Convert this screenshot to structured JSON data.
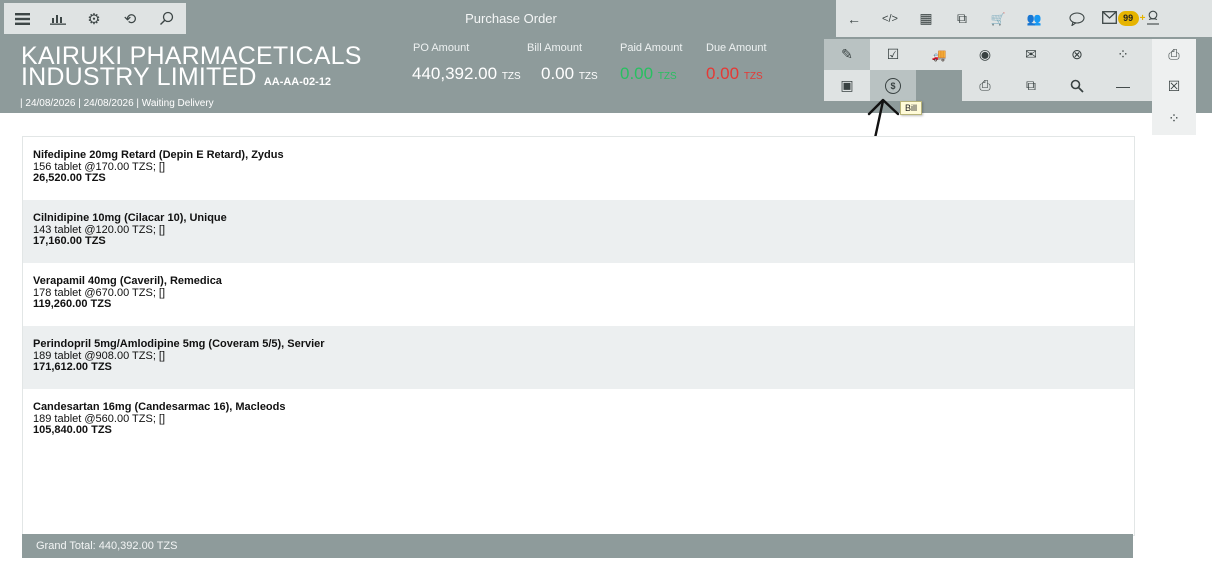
{
  "app": {
    "title": "Purchase Order"
  },
  "toolbar_left": {
    "icons": [
      "menu-icon",
      "chart-icon",
      "settings-icon",
      "history-icon",
      "search-icon"
    ],
    "glyphs": [
      "≡",
      "⫫",
      "⚙",
      "⟲",
      "⚲"
    ]
  },
  "toolbar_right": {
    "glyphs": [
      "←",
      "</>",
      "▦",
      "⧉",
      "🛒",
      "👥",
      "💬",
      "✉",
      "👤"
    ],
    "notification_badge": "99",
    "notification_plus": "+"
  },
  "po": {
    "vendor_line1": "KAIRUKI PHARMACETICALS",
    "vendor_line2": "INDUSTRY LIMITED",
    "code": "AA-AA-02-12",
    "meta": "| 24/08/2026 | 24/08/2026 | Waiting Delivery"
  },
  "amounts": {
    "po_label": "PO Amount",
    "po_value": "440,392.00",
    "bill_label": "Bill Amount",
    "bill_value": "0.00",
    "paid_label": "Paid Amount",
    "paid_value": "0.00",
    "due_label": "Due Amount",
    "due_value": "0.00",
    "currency": "TZS"
  },
  "actions": {
    "edit": "✎",
    "approve": "☑",
    "deliver": "🚚",
    "record": "◉",
    "mail": "✉",
    "cancel": "⊗",
    "loading": "⁘",
    "archive": "▣",
    "bill": "$",
    "print": "⎙",
    "copy": "⧉",
    "search": "⚲",
    "minus": "—",
    "side_print": "⎙",
    "side_excel": "☒",
    "side_loading": "⁘"
  },
  "tooltip": {
    "bill": "Bill"
  },
  "items": [
    {
      "name": "Nifedipine 20mg Retard (Depin E Retard), Zydus",
      "detail": "156 tablet @170.00 TZS; []",
      "amount": "26,520.00 TZS"
    },
    {
      "name": "Cilnidipine 10mg (Cilacar 10), Unique",
      "detail": "143 tablet @120.00 TZS; []",
      "amount": "17,160.00 TZS"
    },
    {
      "name": "Verapamil 40mg (Caveril), Remedica",
      "detail": "178 tablet @670.00 TZS; []",
      "amount": "119,260.00 TZS"
    },
    {
      "name": "Perindopril 5mg/Amlodipine 5mg (Coveram 5/5), Servier",
      "detail": "189 tablet @908.00 TZS; []",
      "amount": "171,612.00 TZS"
    },
    {
      "name": "Candesartan 16mg (Candesarmac 16), Macleods",
      "detail": "189 tablet @560.00 TZS; []",
      "amount": "105,840.00 TZS"
    }
  ],
  "footer": {
    "grand_total": "Grand Total: 440,392.00 TZS"
  },
  "colors": {
    "bar": "#8e9b9b",
    "panel": "#dfe3e3",
    "paid": "#28c061",
    "due": "#e53935",
    "badge": "#e6b400"
  }
}
